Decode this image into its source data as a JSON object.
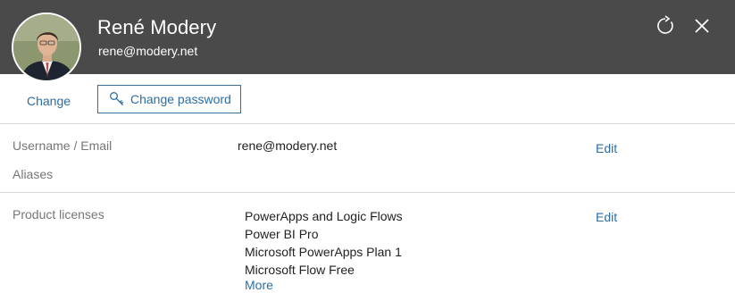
{
  "header": {
    "name": "René Modery",
    "email": "rene@modery.net",
    "colors": {
      "background": "#4a4a4a",
      "text": "#ffffff"
    },
    "icons": [
      "refresh-icon",
      "close-icon"
    ]
  },
  "actions": {
    "change_label": "Change",
    "change_password_label": "Change password",
    "accent": "#2b6ea5"
  },
  "details": {
    "username_label": "Username / Email",
    "username_value": "rene@modery.net",
    "aliases_label": "Aliases",
    "edit_label": "Edit"
  },
  "licenses": {
    "label": "Product licenses",
    "items": [
      "PowerApps and Logic Flows",
      "Power BI Pro",
      "Microsoft PowerApps Plan 1",
      "Microsoft Flow Free"
    ],
    "more_label": "More",
    "edit_label": "Edit"
  }
}
